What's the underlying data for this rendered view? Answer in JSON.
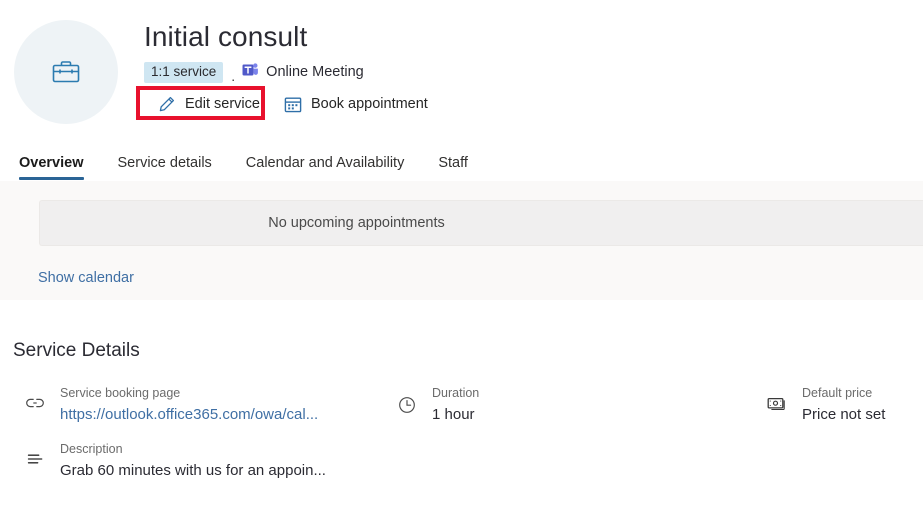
{
  "header": {
    "avatar_icon": "briefcase-icon",
    "title": "Initial consult",
    "badge": "1:1 service",
    "separator": ".",
    "meeting_icon": "teams-icon",
    "meeting_label": "Online Meeting",
    "edit_action": {
      "icon": "pencil-icon",
      "label": "Edit service"
    },
    "book_action": {
      "icon": "calendar-icon",
      "label": "Book appointment"
    },
    "highlight_color": "#e8112d"
  },
  "tabs": [
    {
      "label": "Overview",
      "active": true
    },
    {
      "label": "Service details",
      "active": false
    },
    {
      "label": "Calendar and Availability",
      "active": false
    },
    {
      "label": "Staff",
      "active": false
    }
  ],
  "appointments": {
    "empty_message": "No upcoming appointments",
    "show_calendar_link": "Show calendar"
  },
  "service_details": {
    "heading": "Service Details",
    "items": [
      {
        "icon": "link-icon",
        "label": "Service booking page",
        "value": "https://outlook.office365.com/owa/cal...",
        "is_link": true
      },
      {
        "icon": "clock-icon",
        "label": "Duration",
        "value": "1 hour",
        "is_link": false
      },
      {
        "icon": "money-icon",
        "label": "Default price",
        "value": "Price not set",
        "is_link": false
      },
      {
        "icon": "text-lines-icon",
        "label": "Description",
        "value": "Grab 60 minutes with us for an appoin...",
        "is_link": false
      }
    ]
  },
  "colors": {
    "accent_blue": "#2a6496",
    "link_blue": "#3f6fa4",
    "badge_bg": "#cfe6f2",
    "panel_bg": "#faf9f8",
    "highlight_red": "#e8112d"
  }
}
